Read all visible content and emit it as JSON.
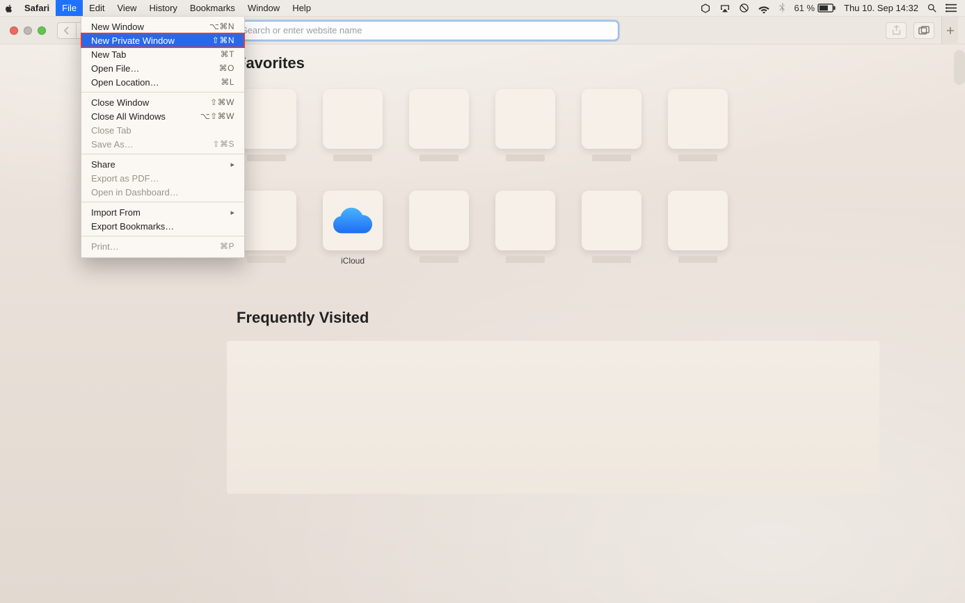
{
  "menubar": {
    "app": "Safari",
    "items": [
      "File",
      "Edit",
      "View",
      "History",
      "Bookmarks",
      "Window",
      "Help"
    ],
    "open_index": 0,
    "battery_pct": "61 %",
    "clock": "Thu 10. Sep  14:32"
  },
  "file_menu": {
    "groups": [
      [
        {
          "label": "New Window",
          "shortcut": "⌥⌘N",
          "disabled": false
        },
        {
          "label": "New Private Window",
          "shortcut": "⇧⌘N",
          "disabled": false,
          "highlight": true
        },
        {
          "label": "New Tab",
          "shortcut": "⌘T",
          "disabled": false
        },
        {
          "label": "Open File…",
          "shortcut": "⌘O",
          "disabled": false
        },
        {
          "label": "Open Location…",
          "shortcut": "⌘L",
          "disabled": false
        }
      ],
      [
        {
          "label": "Close Window",
          "shortcut": "⇧⌘W",
          "disabled": false
        },
        {
          "label": "Close All Windows",
          "shortcut": "⌥⇧⌘W",
          "disabled": false
        },
        {
          "label": "Close Tab",
          "shortcut": "",
          "disabled": true
        },
        {
          "label": "Save As…",
          "shortcut": "⇧⌘S",
          "disabled": true
        }
      ],
      [
        {
          "label": "Share",
          "shortcut": "",
          "disabled": false,
          "submenu": true
        },
        {
          "label": "Export as PDF…",
          "shortcut": "",
          "disabled": true
        },
        {
          "label": "Open in Dashboard…",
          "shortcut": "",
          "disabled": true
        }
      ],
      [
        {
          "label": "Import From",
          "shortcut": "",
          "disabled": false,
          "submenu": true
        },
        {
          "label": "Export Bookmarks…",
          "shortcut": "",
          "disabled": false
        }
      ],
      [
        {
          "label": "Print…",
          "shortcut": "⌘P",
          "disabled": true
        }
      ]
    ]
  },
  "toolbar": {
    "search_placeholder": "Search or enter website name"
  },
  "page": {
    "favorites_title": "Favorites",
    "favorites": [
      {
        "label": ""
      },
      {
        "label": ""
      },
      {
        "label": ""
      },
      {
        "label": ""
      },
      {
        "label": ""
      },
      {
        "label": ""
      },
      {
        "label": ""
      },
      {
        "label": "iCloud",
        "icon": "icloud"
      },
      {
        "label": ""
      },
      {
        "label": ""
      },
      {
        "label": ""
      },
      {
        "label": ""
      }
    ],
    "frequently_title": "Frequently Visited"
  }
}
